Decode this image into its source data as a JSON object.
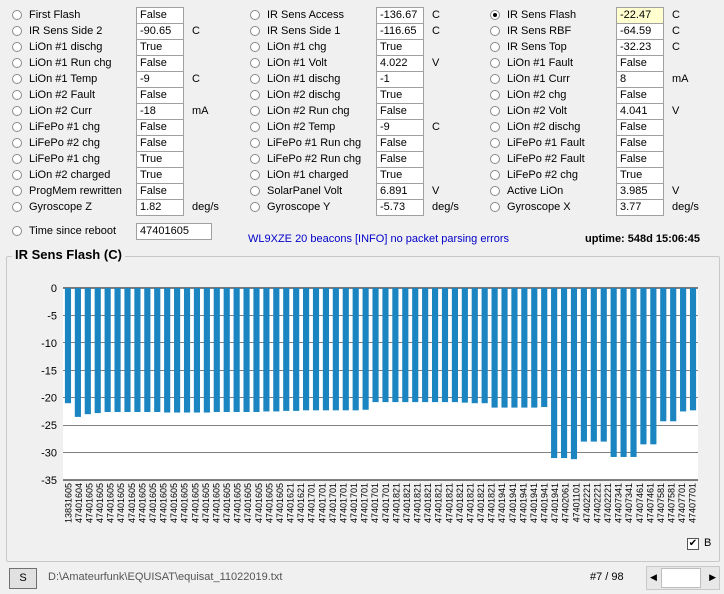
{
  "columns": [
    {
      "x": 12,
      "valX": 136,
      "valW": 48,
      "unitX": 192,
      "rows": [
        {
          "label": "First Flash",
          "value": "False",
          "unit": ""
        },
        {
          "label": "IR Sens Side 2",
          "value": "-90.65",
          "unit": "C"
        },
        {
          "label": "LiOn #1 dischg",
          "value": "True",
          "unit": ""
        },
        {
          "label": "LiOn #1 Run chg",
          "value": "False",
          "unit": ""
        },
        {
          "label": "LiOn #1 Temp",
          "value": "-9",
          "unit": "C"
        },
        {
          "label": "LiOn #2 Fault",
          "value": "False",
          "unit": ""
        },
        {
          "label": "LiOn #2 Curr",
          "value": "-18",
          "unit": "mA"
        },
        {
          "label": "LiFePo #1 chg",
          "value": "False",
          "unit": ""
        },
        {
          "label": "LiFePo #2 chg",
          "value": "False",
          "unit": ""
        },
        {
          "label": "LiFePo #1 chg",
          "value": "True",
          "unit": ""
        },
        {
          "label": "LiOn #2 charged",
          "value": "True",
          "unit": ""
        },
        {
          "label": "ProgMem rewritten",
          "value": "False",
          "unit": ""
        },
        {
          "label": "Gyroscope Z",
          "value": "1.82",
          "unit": "deg/s"
        }
      ]
    },
    {
      "x": 250,
      "valX": 376,
      "valW": 48,
      "unitX": 432,
      "rows": [
        {
          "label": "IR Sens Access",
          "value": "-136.67",
          "unit": "C"
        },
        {
          "label": "IR Sens Side 1",
          "value": "-116.65",
          "unit": "C"
        },
        {
          "label": "LiOn #1 chg",
          "value": "True",
          "unit": ""
        },
        {
          "label": "LiOn #1 Volt",
          "value": "4.022",
          "unit": "V"
        },
        {
          "label": "LiOn #1 dischg",
          "value": "-1",
          "unit": ""
        },
        {
          "label": "LiOn #2 dischg",
          "value": "True",
          "unit": ""
        },
        {
          "label": "LiOn #2 Run chg",
          "value": "False",
          "unit": ""
        },
        {
          "label": "LiOn #2 Temp",
          "value": "-9",
          "unit": "C"
        },
        {
          "label": "LiFePo #1 Run chg",
          "value": "False",
          "unit": ""
        },
        {
          "label": "LiFePo #2 Run chg",
          "value": "False",
          "unit": ""
        },
        {
          "label": "LiOn #1 charged",
          "value": "True",
          "unit": ""
        },
        {
          "label": "SolarPanel Volt",
          "value": "6.891",
          "unit": "V"
        },
        {
          "label": "Gyroscope Y",
          "value": "-5.73",
          "unit": "deg/s"
        }
      ]
    },
    {
      "x": 490,
      "valX": 616,
      "valW": 48,
      "unitX": 672,
      "rows": [
        {
          "label": "IR Sens Flash",
          "value": "-22.47",
          "unit": "C",
          "selected": true
        },
        {
          "label": "IR Sens RBF",
          "value": "-64.59",
          "unit": "C"
        },
        {
          "label": "IR Sens Top",
          "value": "-32.23",
          "unit": "C"
        },
        {
          "label": "LiOn #1 Fault",
          "value": "False",
          "unit": ""
        },
        {
          "label": "LiOn #1 Curr",
          "value": "8",
          "unit": "mA"
        },
        {
          "label": "LiOn #2 chg",
          "value": "False",
          "unit": ""
        },
        {
          "label": "LiOn #2 Volt",
          "value": "4.041",
          "unit": "V"
        },
        {
          "label": "LiOn #2 dischg",
          "value": "False",
          "unit": ""
        },
        {
          "label": "LiFePo #1 Fault",
          "value": "False",
          "unit": ""
        },
        {
          "label": "LiFePo #2 Fault",
          "value": "False",
          "unit": ""
        },
        {
          "label": "LiFePo #2 chg",
          "value": "True",
          "unit": ""
        },
        {
          "label": "Active LiOn",
          "value": "3.985",
          "unit": "V"
        },
        {
          "label": "Gyroscope X",
          "value": "3.77",
          "unit": "deg/s"
        }
      ]
    }
  ],
  "time_since_reboot": {
    "label": "Time since reboot",
    "value": "47401605"
  },
  "status_message": "WL9XZE 20 beacons [INFO] no packet parsing errors",
  "uptime": "uptime: 548d 15:06:45",
  "chart_title": "IR Sens Flash (C)",
  "checkbox_label": "B",
  "button_label": "S",
  "file_path": "D:\\Amateurfunk\\EQUISAT\\equisat_11022019.txt",
  "record_counter": "#7 / 98",
  "colors": {
    "bar": "#1a85c0",
    "grid": "#000000"
  },
  "chart_data": {
    "type": "bar",
    "title": "IR Sens Flash (C)",
    "ylim": [
      -35,
      0
    ],
    "yticks": [
      0,
      -5,
      -10,
      -15,
      -20,
      -25,
      -30,
      -35
    ],
    "grid": true,
    "categories": [
      "13831605",
      "47401604",
      "47401605",
      "47401605",
      "47401605",
      "47401605",
      "47401605",
      "47401605",
      "47401605",
      "47401605",
      "47401605",
      "47401605",
      "47401605",
      "47401605",
      "47401605",
      "47401605",
      "47401605",
      "47401605",
      "47401605",
      "47401605",
      "47401605",
      "47401621",
      "47401621",
      "47401701",
      "47401701",
      "47401701",
      "47401701",
      "47401701",
      "47401701",
      "47401701",
      "47401701",
      "47401821",
      "47401821",
      "47401821",
      "47401821",
      "47401821",
      "47401821",
      "47401821",
      "47401821",
      "47401821",
      "47401821",
      "47401941",
      "47401941",
      "47401941",
      "47401941",
      "47401941",
      "47401941",
      "47402061",
      "47401101",
      "47402221",
      "47402221",
      "47402221",
      "47407341",
      "47407341",
      "47407461",
      "47407461",
      "47407581",
      "47407581",
      "47407701",
      "47407701"
    ],
    "values": [
      -21.0,
      -23.5,
      -23.0,
      -22.8,
      -22.6,
      -22.6,
      -22.6,
      -22.6,
      -22.6,
      -22.6,
      -22.7,
      -22.7,
      -22.7,
      -22.7,
      -22.7,
      -22.6,
      -22.6,
      -22.6,
      -22.6,
      -22.6,
      -22.5,
      -22.5,
      -22.4,
      -22.4,
      -22.3,
      -22.3,
      -22.3,
      -22.3,
      -22.3,
      -22.3,
      -22.2,
      -20.8,
      -20.8,
      -20.8,
      -20.8,
      -20.8,
      -20.8,
      -20.8,
      -20.8,
      -20.8,
      -20.9,
      -21.0,
      -21.0,
      -21.8,
      -21.8,
      -21.8,
      -21.8,
      -21.8,
      -21.7,
      -31.0,
      -31.0,
      -31.2,
      -28.0,
      -28.0,
      -28.0,
      -30.8,
      -30.8,
      -30.8,
      -28.5,
      -28.5,
      -24.3,
      -24.3,
      -22.5,
      -22.3
    ]
  }
}
